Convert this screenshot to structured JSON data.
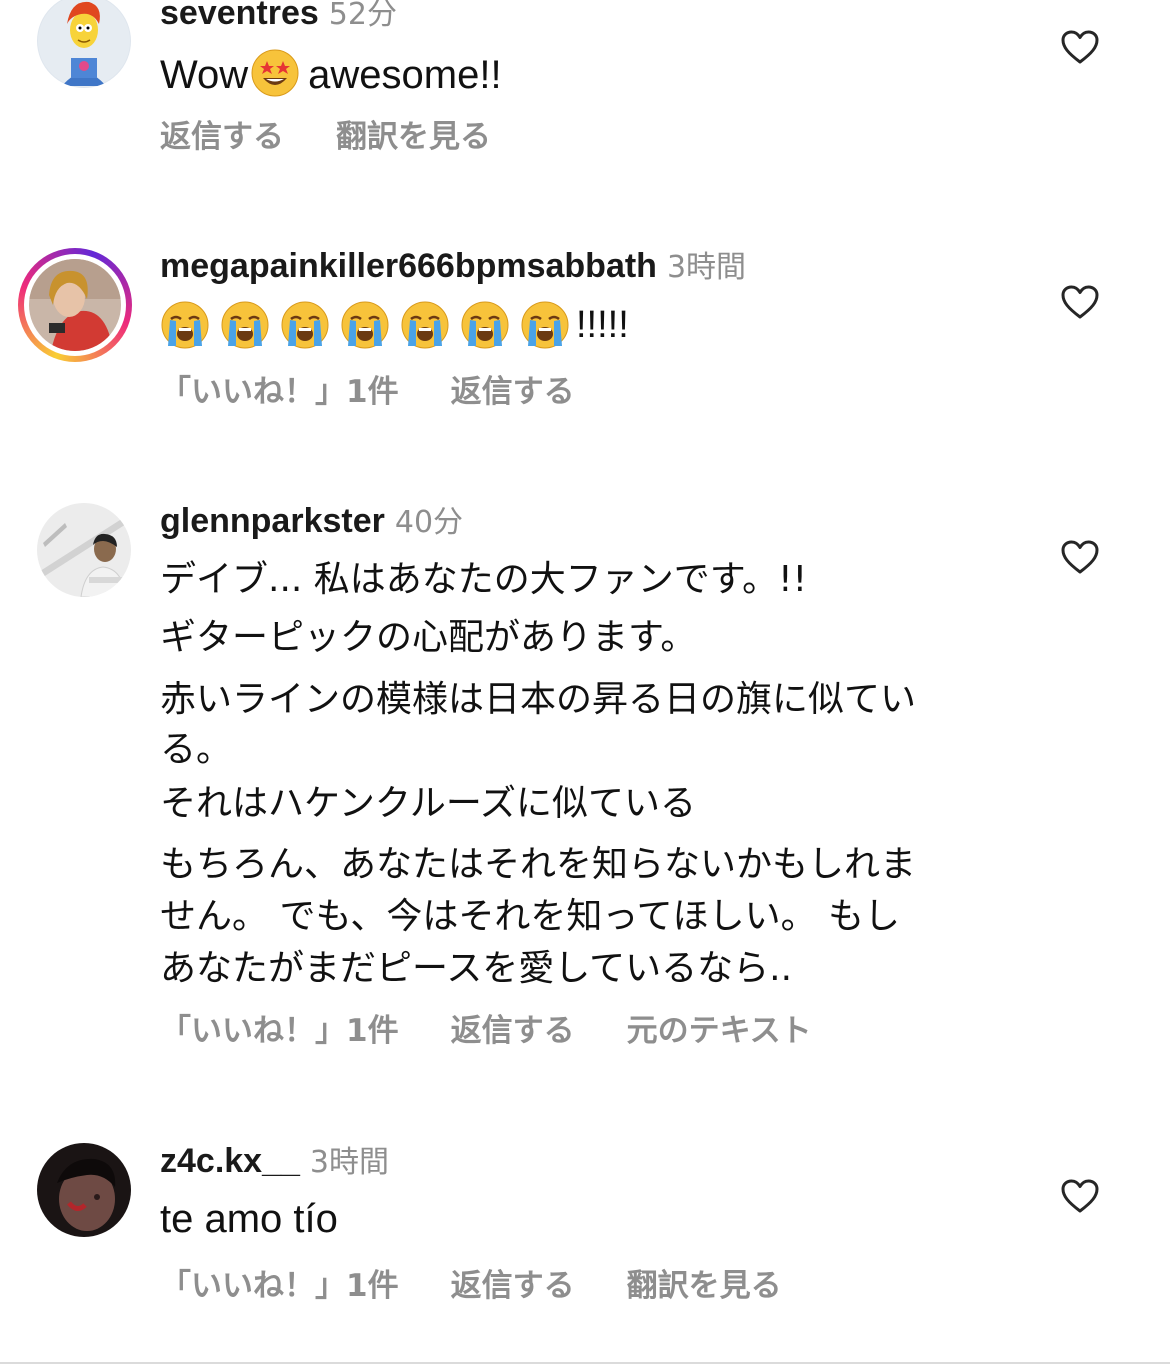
{
  "comments": [
    {
      "username": "seventres",
      "time": "52分",
      "text": "awesome!!",
      "prefix": "Wow",
      "emoji": "star-struck-emoji",
      "actions": [
        "返信する",
        "翻訳を見る"
      ]
    },
    {
      "username": "megapainkiller666bpmsabbath",
      "time": "3時間",
      "emoji_count": 7,
      "emoji": "loudly-crying-face-emoji",
      "suffix": "!!!!!",
      "actions": [
        "「いいね！」1件",
        "返信する"
      ]
    },
    {
      "username": "glennparkster",
      "time": "40分",
      "lines": [
        "デイブ... 私はあなたの大ファンです。!!",
        "ギターピックの心配があります。",
        "赤いラインの模様は日本の昇る日の旗に似てい",
        "る。",
        "それはハケンクルーズに似ている",
        "もちろん、あなたはそれを知らないかもしれま",
        "せん。 でも、今はそれを知ってほしい。 もし",
        "あなたがまだピースを愛しているなら.."
      ],
      "actions": [
        "「いいね！」1件",
        "返信する",
        "元のテキスト"
      ]
    },
    {
      "username": "z4c.kx__",
      "time": "3時間",
      "text": "te amo tío",
      "actions": [
        "「いいね！」1件",
        "返信する",
        "翻訳を見る"
      ]
    }
  ],
  "icons": {
    "like": "heart-outline-icon"
  },
  "colors": {
    "secondary_text": "#8e8e8e",
    "primary_text": "#111111",
    "story_ring": "#ee2a7b"
  }
}
